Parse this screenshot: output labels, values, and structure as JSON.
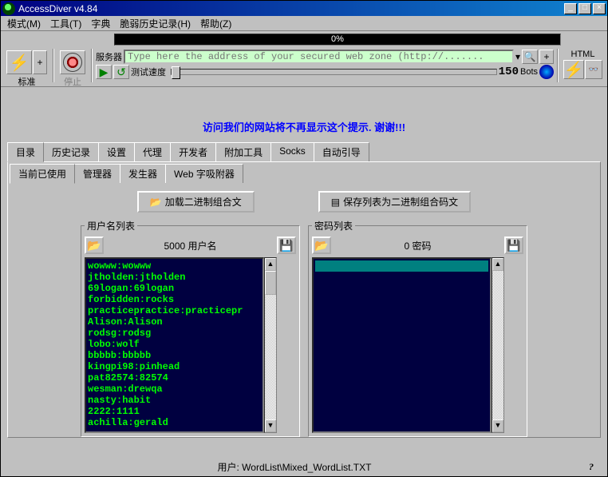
{
  "window": {
    "title": "AccessDiver v4.84"
  },
  "menu": [
    "模式(M)",
    "工具(T)",
    "字典",
    "脆弱历史记录(H)",
    "帮助(Z)"
  ],
  "progress": "0%",
  "toolbar": {
    "std_label": "标准",
    "stop_label": "停止",
    "server_label": "服务器",
    "address_placeholder": "Type here the address of your secured web zone (http://.......",
    "speed_label": "测试速度",
    "bots_num": "150",
    "bots_label": "Bots",
    "html_label": "HTML"
  },
  "message": "访问我们的网站将不再显示这个提示.  谢谢!!!",
  "main_tabs": [
    "目录",
    "历史记录",
    "设置",
    "代理",
    "开发者",
    "附加工具",
    "Socks",
    "自动引导"
  ],
  "sub_tabs": [
    "当前已使用",
    "管理器",
    "发生器",
    "Web 字吸附器"
  ],
  "buttons": {
    "load_combo": "加载二进制组合文",
    "save_combo": "保存列表为二进制组合码文"
  },
  "left_panel": {
    "legend": "用户名列表",
    "count": "5000 用户名",
    "items": [
      "wowww:wowww",
      "jtholden:jtholden",
      "69logan:69logan",
      "forbidden:rocks",
      "practicepractice:practicepr",
      "Alison:Alison",
      "rodsg:rodsg",
      "lobo:wolf",
      "bbbbb:bbbbb",
      "kingpi98:pinhead",
      "pat82574:82574",
      "wesman:drewqa",
      "nasty:habit",
      "2222:1111",
      "achilla:gerald"
    ]
  },
  "right_panel": {
    "legend": "密码列表",
    "count": "0 密码"
  },
  "status": {
    "text": "用户: WordList\\Mixed_WordList.TXT",
    "help": "?"
  }
}
